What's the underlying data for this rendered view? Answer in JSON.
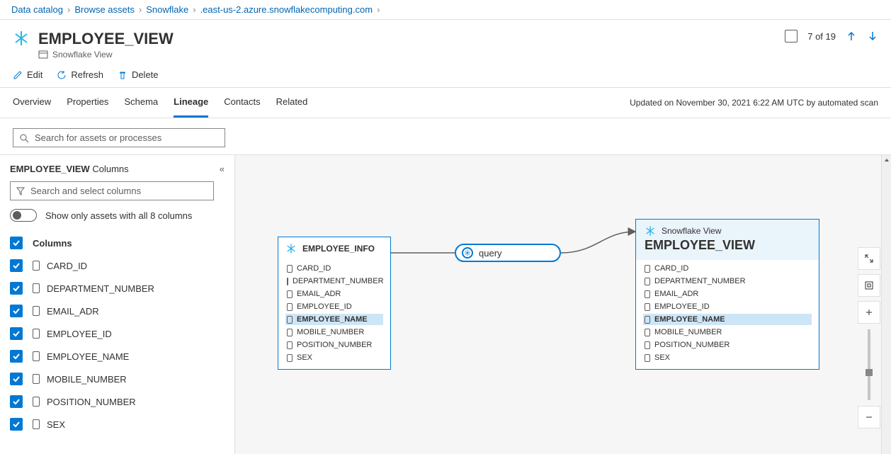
{
  "breadcrumb": {
    "items": [
      "Data catalog",
      "Browse assets",
      "Snowflake",
      ".east-us-2.azure.snowflakecomputing.com"
    ]
  },
  "header": {
    "title": "EMPLOYEE_VIEW",
    "subtype_label": "Snowflake View",
    "paging_text": "7 of 19"
  },
  "commands": {
    "edit": "Edit",
    "refresh": "Refresh",
    "delete": "Delete"
  },
  "tabs": {
    "overview": "Overview",
    "properties": "Properties",
    "schema": "Schema",
    "lineage": "Lineage",
    "contacts": "Contacts",
    "related": "Related",
    "active": "Lineage"
  },
  "updated_text": "Updated on November 30, 2021 6:22 AM UTC by automated scan",
  "search_placeholder": "Search for assets or processes",
  "leftpane": {
    "title_name": "EMPLOYEE_VIEW",
    "title_suffix": "Columns",
    "column_search_placeholder": "Search and select columns",
    "toggle_label": "Show only assets with all 8 columns",
    "columns_header": "Columns",
    "columns": [
      "CARD_ID",
      "DEPARTMENT_NUMBER",
      "EMAIL_ADR",
      "EMPLOYEE_ID",
      "EMPLOYEE_NAME",
      "MOBILE_NUMBER",
      "POSITION_NUMBER",
      "SEX"
    ]
  },
  "diagram": {
    "source": {
      "title": "EMPLOYEE_INFO",
      "cols": [
        "CARD_ID",
        "DEPARTMENT_NUMBER",
        "EMAIL_ADR",
        "EMPLOYEE_ID",
        "EMPLOYEE_NAME",
        "MOBILE_NUMBER",
        "POSITION_NUMBER",
        "SEX"
      ],
      "highlight_index": 4
    },
    "process": {
      "label": "query"
    },
    "target": {
      "type_label": "Snowflake View",
      "title": "EMPLOYEE_VIEW",
      "cols": [
        "CARD_ID",
        "DEPARTMENT_NUMBER",
        "EMAIL_ADR",
        "EMPLOYEE_ID",
        "EMPLOYEE_NAME",
        "MOBILE_NUMBER",
        "POSITION_NUMBER",
        "SEX"
      ],
      "highlight_index": 4
    }
  }
}
